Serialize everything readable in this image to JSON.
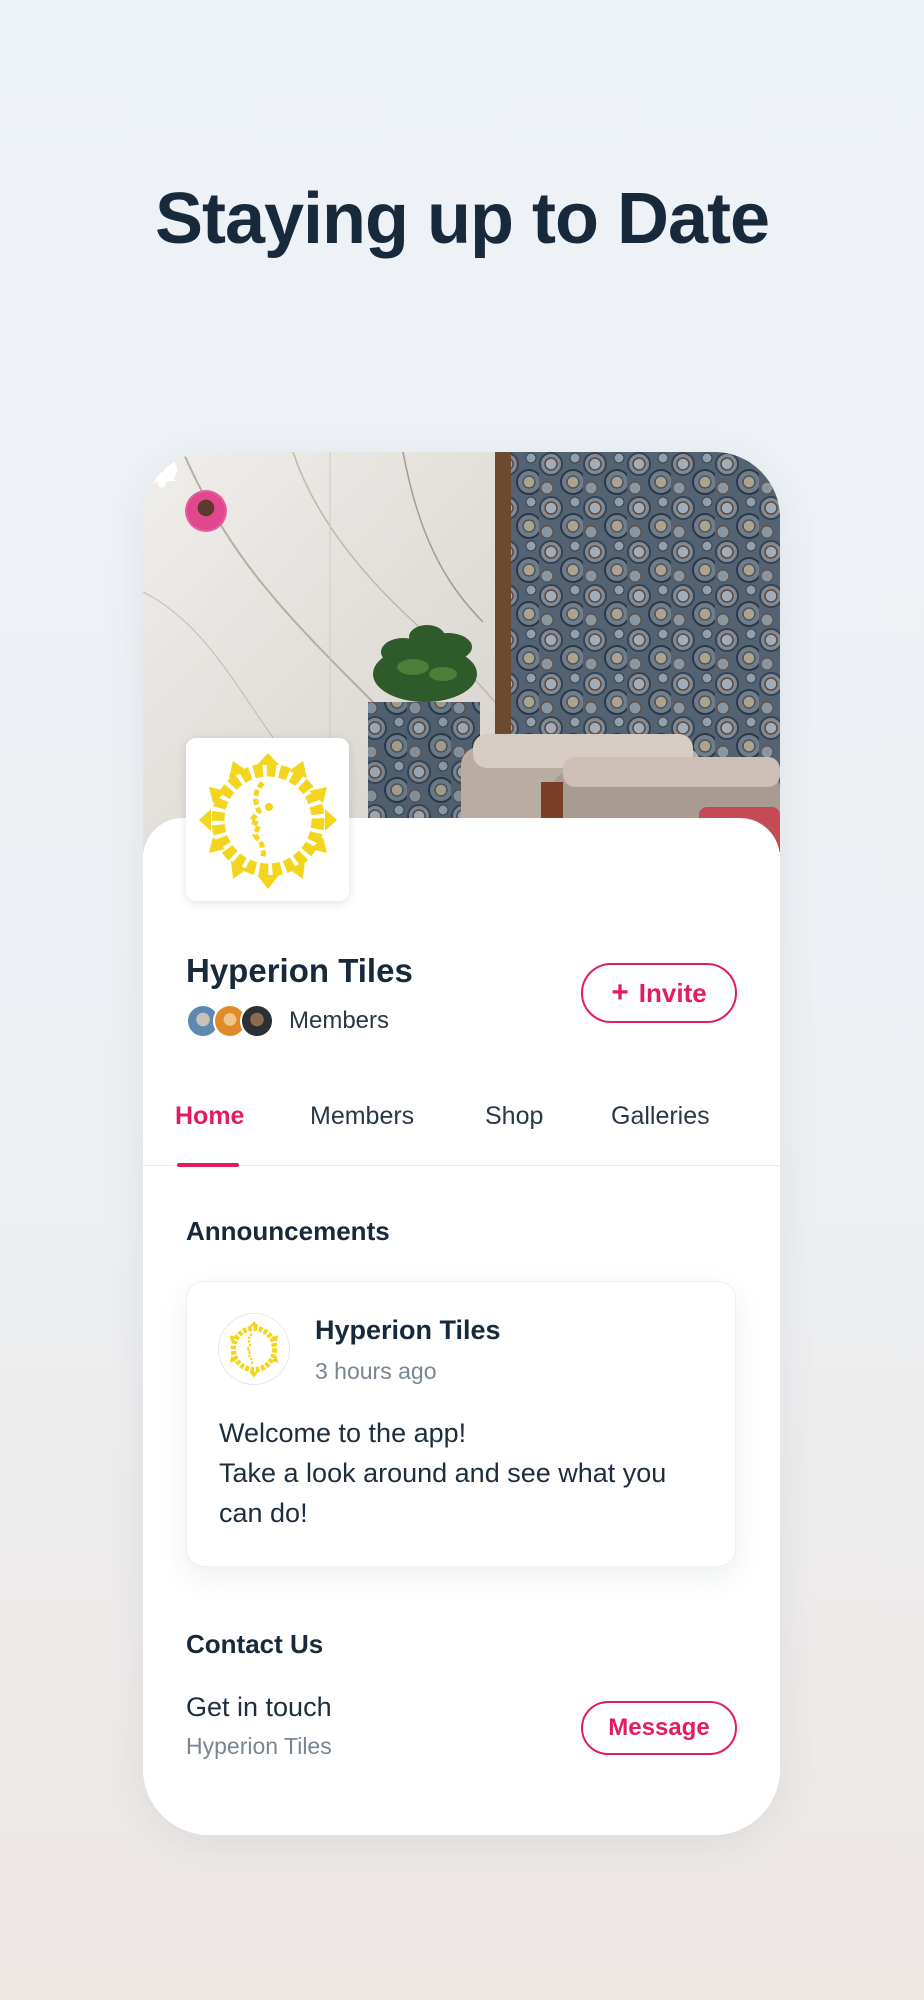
{
  "headline": "Staying up to Date",
  "colors": {
    "accent": "#e21c62",
    "text_dark": "#17293b",
    "text_muted": "#7a8592",
    "logo_yellow": "#f2d51c"
  },
  "header": {
    "icons": [
      "avatar",
      "chat-bubble-icon",
      "bell-icon"
    ]
  },
  "group": {
    "name": "Hyperion Tiles",
    "members_label": "Members",
    "invite_label": "Invite",
    "invite_icon": "plus-icon"
  },
  "tabs": [
    {
      "label": "Home",
      "active": true
    },
    {
      "label": "Members",
      "active": false
    },
    {
      "label": "Shop",
      "active": false
    },
    {
      "label": "Galleries",
      "active": false
    }
  ],
  "announcements": {
    "title": "Announcements",
    "post": {
      "author": "Hyperion Tiles",
      "time": "3 hours ago",
      "body_lines": [
        "Welcome to the app!",
        "Take a look around and see what you",
        "can do!"
      ]
    }
  },
  "contact": {
    "title": "Contact Us",
    "line": "Get in touch",
    "sub": "Hyperion Tiles",
    "button_label": "Message"
  }
}
